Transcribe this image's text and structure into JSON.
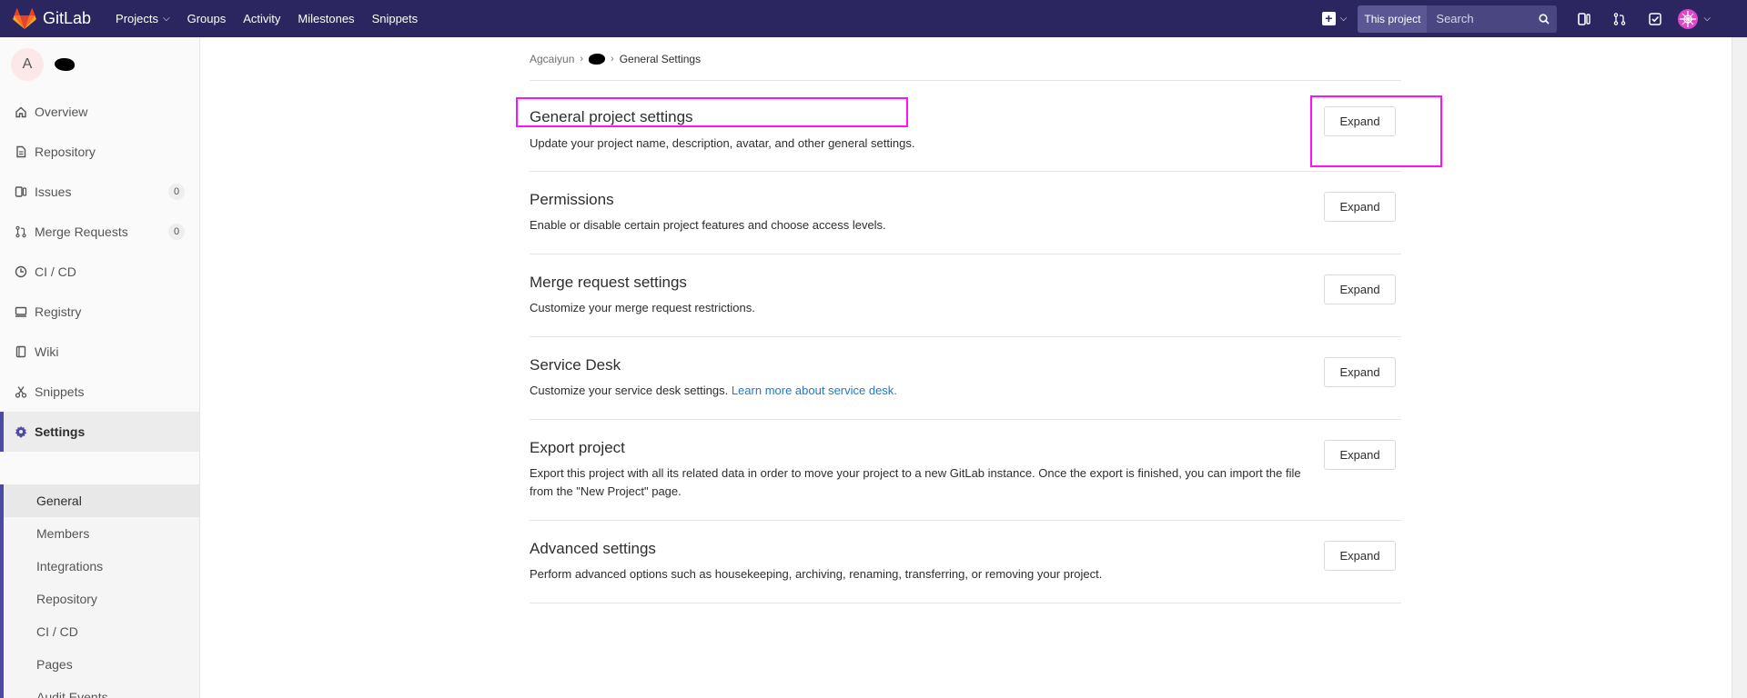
{
  "navbar": {
    "brand": "GitLab",
    "links": [
      {
        "label": "Projects",
        "has_chevron": true
      },
      {
        "label": "Groups",
        "has_chevron": false
      },
      {
        "label": "Activity",
        "has_chevron": false
      },
      {
        "label": "Milestones",
        "has_chevron": false
      },
      {
        "label": "Snippets",
        "has_chevron": false
      }
    ],
    "search_scope": "This project",
    "search_placeholder": "Search",
    "colors": {
      "background": "#2b2660",
      "search": "#4a4681"
    }
  },
  "sidebar": {
    "project_initial": "A",
    "items": [
      {
        "label": "Overview",
        "icon": "home-icon"
      },
      {
        "label": "Repository",
        "icon": "file-icon"
      },
      {
        "label": "Issues",
        "icon": "issues-icon",
        "count": "0"
      },
      {
        "label": "Merge Requests",
        "icon": "merge-request-icon",
        "count": "0"
      },
      {
        "label": "CI / CD",
        "icon": "rocket-icon"
      },
      {
        "label": "Registry",
        "icon": "container-icon"
      },
      {
        "label": "Wiki",
        "icon": "book-icon"
      },
      {
        "label": "Snippets",
        "icon": "scissors-icon"
      },
      {
        "label": "Settings",
        "icon": "gear-icon"
      }
    ],
    "settings_sub": [
      "General",
      "Members",
      "Integrations",
      "Repository",
      "CI / CD",
      "Pages",
      "Audit Events"
    ],
    "active_sub": "General"
  },
  "breadcrumb": {
    "root": "Agcaiyun",
    "current": "General Settings"
  },
  "sections": [
    {
      "title": "General project settings",
      "desc": "Update your project name, description, avatar, and other general settings.",
      "button": "Expand"
    },
    {
      "title": "Permissions",
      "desc": "Enable or disable certain project features and choose access levels.",
      "button": "Expand"
    },
    {
      "title": "Merge request settings",
      "desc": "Customize your merge request restrictions.",
      "button": "Expand"
    },
    {
      "title": "Service Desk",
      "desc": "Customize your service desk settings.",
      "link": "Learn more about service desk.",
      "button": "Expand"
    },
    {
      "title": "Export project",
      "desc": "Export this project with all its related data in order to move your project to a new GitLab instance. Once the export is finished, you can import the file from the \"New Project\" page.",
      "button": "Expand"
    },
    {
      "title": "Advanced settings",
      "desc": "Perform advanced options such as housekeeping, archiving, renaming, transferring, or removing your project.",
      "button": "Expand"
    }
  ],
  "colors": {
    "highlight": "#ff10ff",
    "link": "#1f78d1",
    "active_indicator": "#4b4ba3"
  }
}
